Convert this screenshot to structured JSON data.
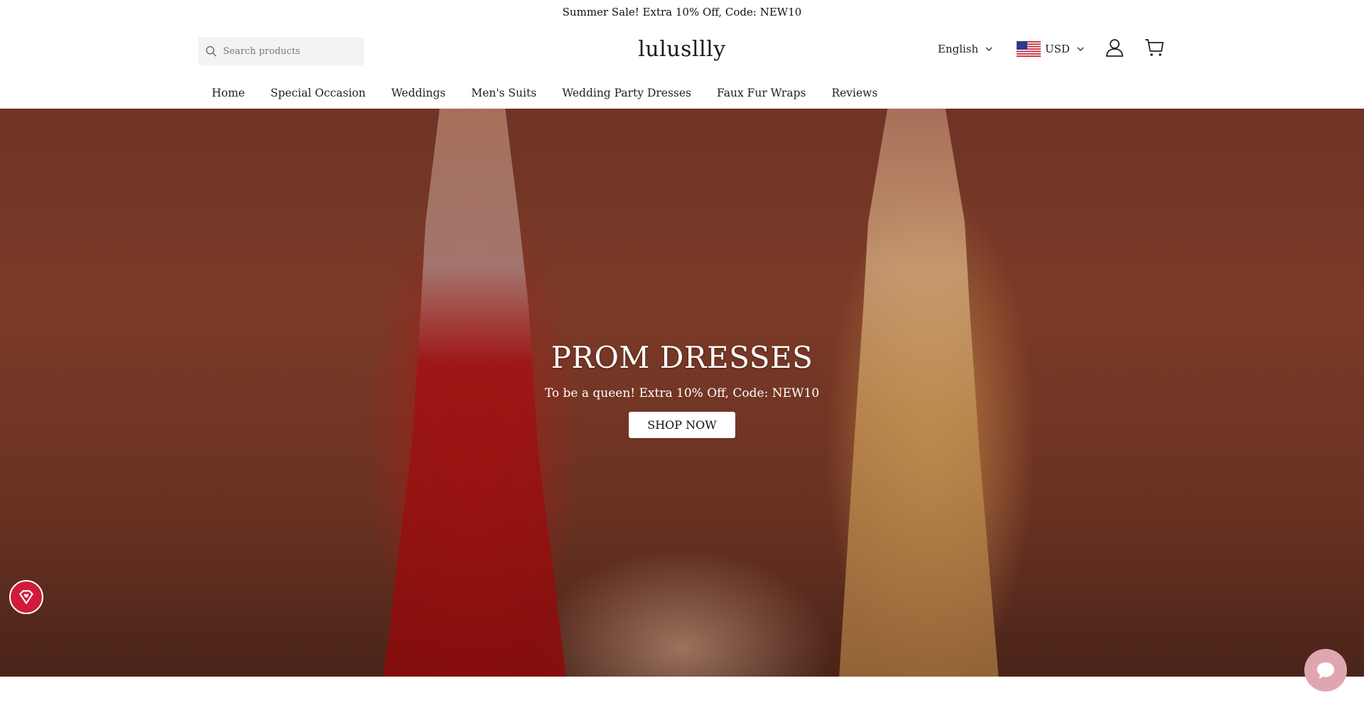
{
  "announcement": "Summer Sale! Extra 10% Off, Code: NEW10",
  "search": {
    "placeholder": "Search products"
  },
  "logo": "lulusllly",
  "language": {
    "selected": "English"
  },
  "currency": {
    "selected": "USD"
  },
  "nav": {
    "items": [
      {
        "label": "Home"
      },
      {
        "label": "Special Occasion"
      },
      {
        "label": "Weddings"
      },
      {
        "label": "Men's Suits"
      },
      {
        "label": "Wedding Party Dresses"
      },
      {
        "label": "Faux Fur Wraps"
      },
      {
        "label": "Reviews"
      }
    ]
  },
  "hero": {
    "title": "PROM DRESSES",
    "subtitle": "To be a queen! Extra 10% Off, Code: NEW10",
    "button": "SHOP NOW"
  },
  "icons": {
    "search": "search-icon",
    "chevron": "chevron-down-icon",
    "flag": "us-flag-icon",
    "user": "user-icon",
    "cart": "cart-icon",
    "badge": "diamond-heart-icon",
    "chat": "chat-icon"
  },
  "colors": {
    "badge": "#d21a3b",
    "chat": "#e0a6b0"
  }
}
